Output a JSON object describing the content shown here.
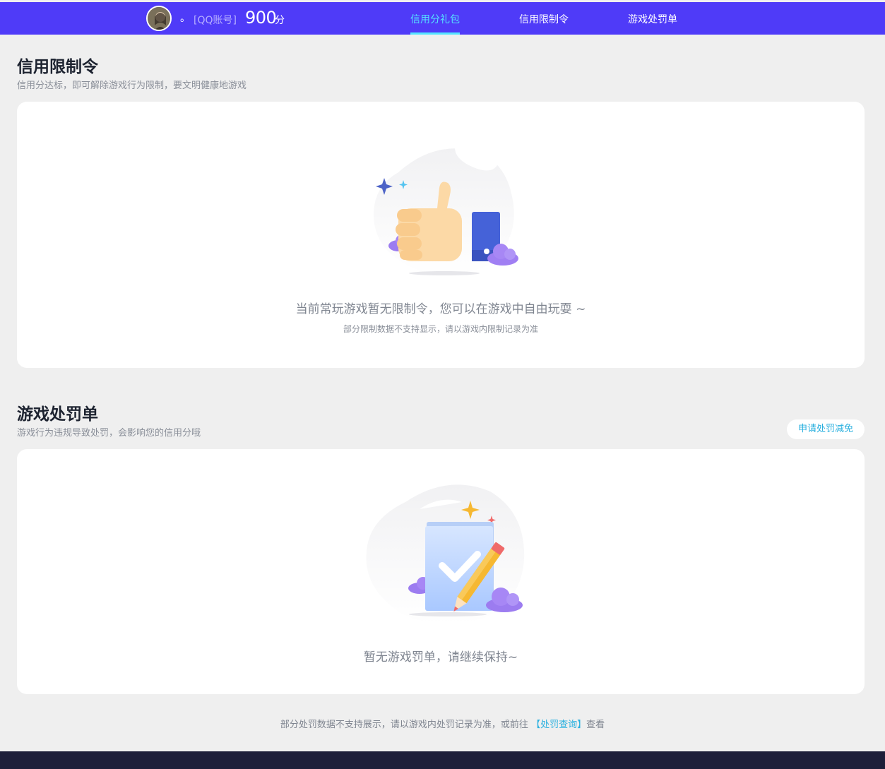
{
  "header": {
    "nickname": "。",
    "account_type": "[QQ账号]",
    "score": "900",
    "score_unit": "分",
    "nav": [
      {
        "label": "信用分礼包",
        "active": true
      },
      {
        "label": "信用限制令",
        "active": false
      },
      {
        "label": "游戏处罚单",
        "active": false
      }
    ],
    "accent": "#4f3bf8",
    "active_color": "#55e4ff"
  },
  "restriction": {
    "title": "信用限制令",
    "subtitle": "信用分达标，即可解除游戏行为限制，要文明健康地游戏",
    "empty_text": "当前常玩游戏暂无限制令，您可以在游戏中自由玩耍 ~",
    "empty_note": "部分限制数据不支持显示，请以游戏内限制记录为准"
  },
  "penalty": {
    "title": "游戏处罚单",
    "subtitle": "游戏行为违规导致处罚，会影响您的信用分哦",
    "apply_button": "申请处罚减免",
    "empty_text": "暂无游戏罚单，请继续保持~"
  },
  "footer": {
    "note_prefix": "部分处罚数据不支持展示，请以游戏内处罚记录为准，或前往",
    "link": "【处罚查询】",
    "note_suffix": "查看"
  }
}
